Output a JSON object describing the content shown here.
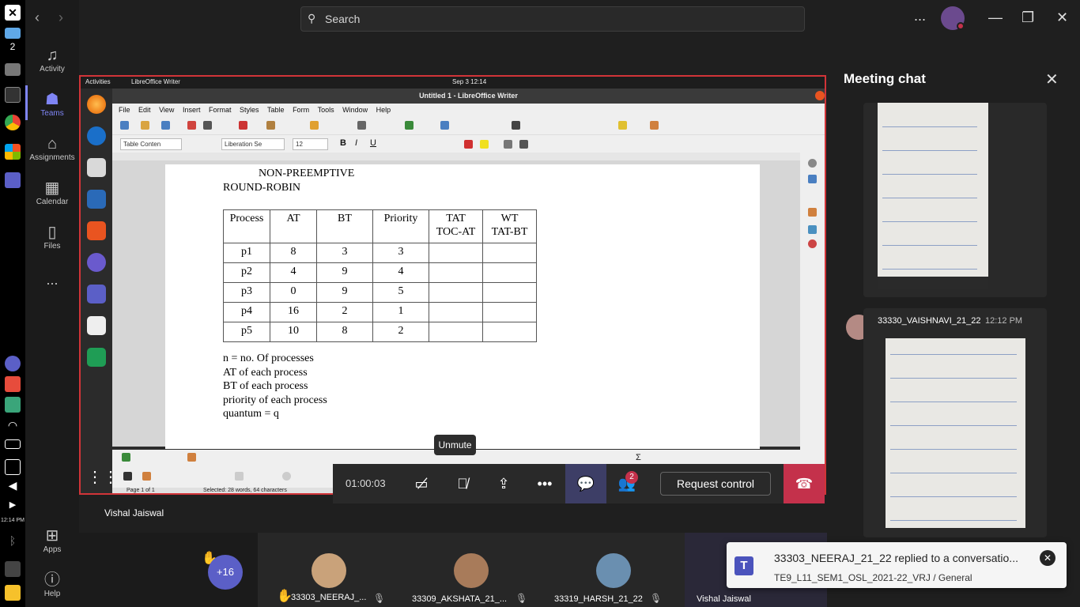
{
  "os": {
    "clock": "12:14 PM",
    "workspace_num": "2"
  },
  "rail": {
    "items": [
      {
        "label": "Activity",
        "icon": "bell-icon"
      },
      {
        "label": "Teams",
        "icon": "teams-icon",
        "active": true
      },
      {
        "label": "Assignments",
        "icon": "assignments-icon"
      },
      {
        "label": "Calendar",
        "icon": "calendar-icon"
      },
      {
        "label": "Files",
        "icon": "files-icon"
      }
    ],
    "more": "...",
    "apps": "Apps",
    "help": "Help"
  },
  "titlebar": {
    "search_placeholder": "Search",
    "more": "...",
    "accent": "#7f85f5"
  },
  "share": {
    "gnome_activities": "Activities",
    "gnome_app": "LibreOffice Writer",
    "gnome_clock": "Sep 3  12:14",
    "window_title": "Untitled 1 - LibreOffice Writer",
    "menu": [
      "File",
      "Edit",
      "View",
      "Insert",
      "Format",
      "Styles",
      "Table",
      "Form",
      "Tools",
      "Window",
      "Help"
    ],
    "style_box": "Table Conten",
    "font_box": "Liberation Se",
    "size_box": "12",
    "status": "Page 1 of 1",
    "status_selected": "Selected: 28 words, 64 characters",
    "doc": {
      "heading1": "NON-PREEMPTIVE",
      "heading2": "ROUND-ROBIN",
      "headers": [
        "Process",
        "AT",
        "BT",
        "Priority",
        "TAT\nTOC-AT",
        "WT\nTAT-BT"
      ],
      "rows": [
        [
          "p1",
          "8",
          "3",
          "3",
          "",
          ""
        ],
        [
          "p2",
          "4",
          "9",
          "4",
          "",
          ""
        ],
        [
          "p3",
          "0",
          "9",
          "5",
          "",
          ""
        ],
        [
          "p4",
          "16",
          "2",
          "1",
          "",
          ""
        ],
        [
          "p5",
          "10",
          "8",
          "2",
          "",
          ""
        ]
      ],
      "notes": [
        "n = no. Of processes",
        "AT of each process",
        "BT of each process",
        "priority of each process",
        "quantum = q"
      ]
    }
  },
  "call": {
    "timer": "01:00:03",
    "unmute_tooltip": "Unmute",
    "request_control": "Request control",
    "participants_badge": "2",
    "presenter": "Vishal Jaiswal",
    "hangup_color": "#c4314b"
  },
  "participants": {
    "more_count": "+16",
    "tiles": [
      {
        "name": "33303_NEERAJ_...",
        "hand": true
      },
      {
        "name": "33309_AKSHATA_21_..."
      },
      {
        "name": "33319_HARSH_21_22"
      },
      {
        "name": "Vishal Jaiswal"
      }
    ]
  },
  "chat": {
    "title": "Meeting chat",
    "message_author": "33330_VAISHNAVI_21_22",
    "message_time": "12:12 PM"
  },
  "toast": {
    "title": "33303_NEERAJ_21_22 replied to a conversatio...",
    "subtitle": "TE9_L11_SEM1_OSL_2021-22_VRJ / General"
  }
}
